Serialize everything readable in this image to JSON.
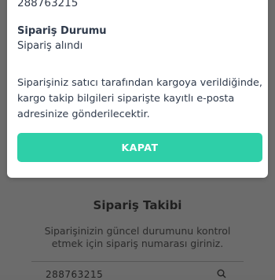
{
  "background": {
    "title": "Sipariş Takibi",
    "description": "Siparişinizin güncel durumunu kontrol etmek için sipariş numarası giriniz.",
    "input_value": "288763215"
  },
  "modal": {
    "order_number": "288763215",
    "status_label": "Sipariş Durumu",
    "status_value": "Sipariş alındı",
    "info": "Siparişiniz satıcı tarafından kargoya verildiğinde, kargo takip bilgileri siparişte kayıtlı e-posta adresinize gönderilecektir.",
    "close_label": "KAPAT"
  },
  "colors": {
    "accent": "#2ecfa8",
    "overlay": "#6c6c6c",
    "text": "#2f3a4b"
  },
  "icons": {
    "search": "search-icon"
  }
}
